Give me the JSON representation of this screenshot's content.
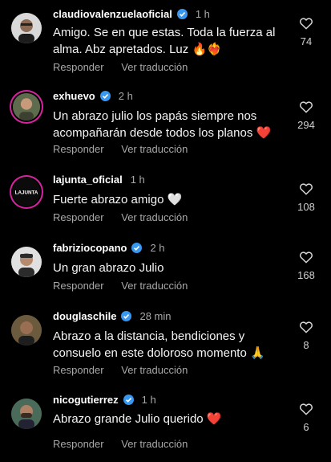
{
  "labels": {
    "reply": "Responder",
    "translate": "Ver traducción"
  },
  "comments": [
    {
      "username": "claudiovalenzuelaoficial",
      "verified": true,
      "time": "1 h",
      "lines": [
        "Amigo. Se en que estas.  Toda la fuerza al",
        "alma. Abz apretados. Luz 🔥❤️‍🔥"
      ],
      "likes": "74"
    },
    {
      "username": "exhuevo",
      "verified": true,
      "time": "2 h",
      "lines": [
        "Un abrazo julio los papás siempre nos",
        "acompañarán desde todos los planos ❤️"
      ],
      "likes": "294"
    },
    {
      "username": "lajunta_oficial",
      "verified": false,
      "time": "1 h",
      "lines": [
        "Fuerte abrazo  amigo 🤍"
      ],
      "likes": "108",
      "avatar_text": "LAJUNTA"
    },
    {
      "username": "fabriziocopano",
      "verified": true,
      "time": "2 h",
      "lines": [
        "Un gran abrazo Julio"
      ],
      "likes": "168"
    },
    {
      "username": "douglaschile",
      "verified": true,
      "time": "28 min",
      "lines": [
        "Abrazo a la distancia, bendiciones y",
        "consuelo en este doloroso momento 🙏"
      ],
      "likes": "8"
    },
    {
      "username": "nicogutierrez",
      "verified": true,
      "time": "1 h",
      "lines": [
        "Abrazo grande Julio querido ❤️"
      ],
      "likes": "6"
    }
  ],
  "colors": {
    "verified": "#3897f0",
    "background": "#000000",
    "secondary_text": "#a8a8a8"
  },
  "icons": {
    "like": "heart-outline-icon",
    "verified": "verified-badge-icon"
  }
}
